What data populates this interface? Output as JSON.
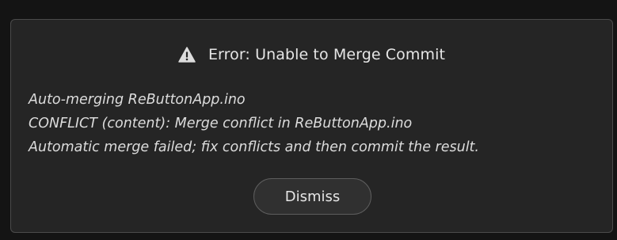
{
  "dialog": {
    "title": "Error: Unable to Merge Commit",
    "title_icon": "warning-triangle-icon",
    "messages": [
      "Auto-merging ReButtonApp.ino",
      "CONFLICT (content): Merge conflict in ReButtonApp.ino",
      "Automatic merge failed; fix conflicts and then commit the result."
    ],
    "dismiss_label": "Dismiss"
  },
  "colors": {
    "background": "#141414",
    "dialog_background": "#252525",
    "dialog_border": "#4b4b4b",
    "text": "#e6e6e6",
    "button_background": "#303030",
    "button_border": "#5e5e5e"
  }
}
